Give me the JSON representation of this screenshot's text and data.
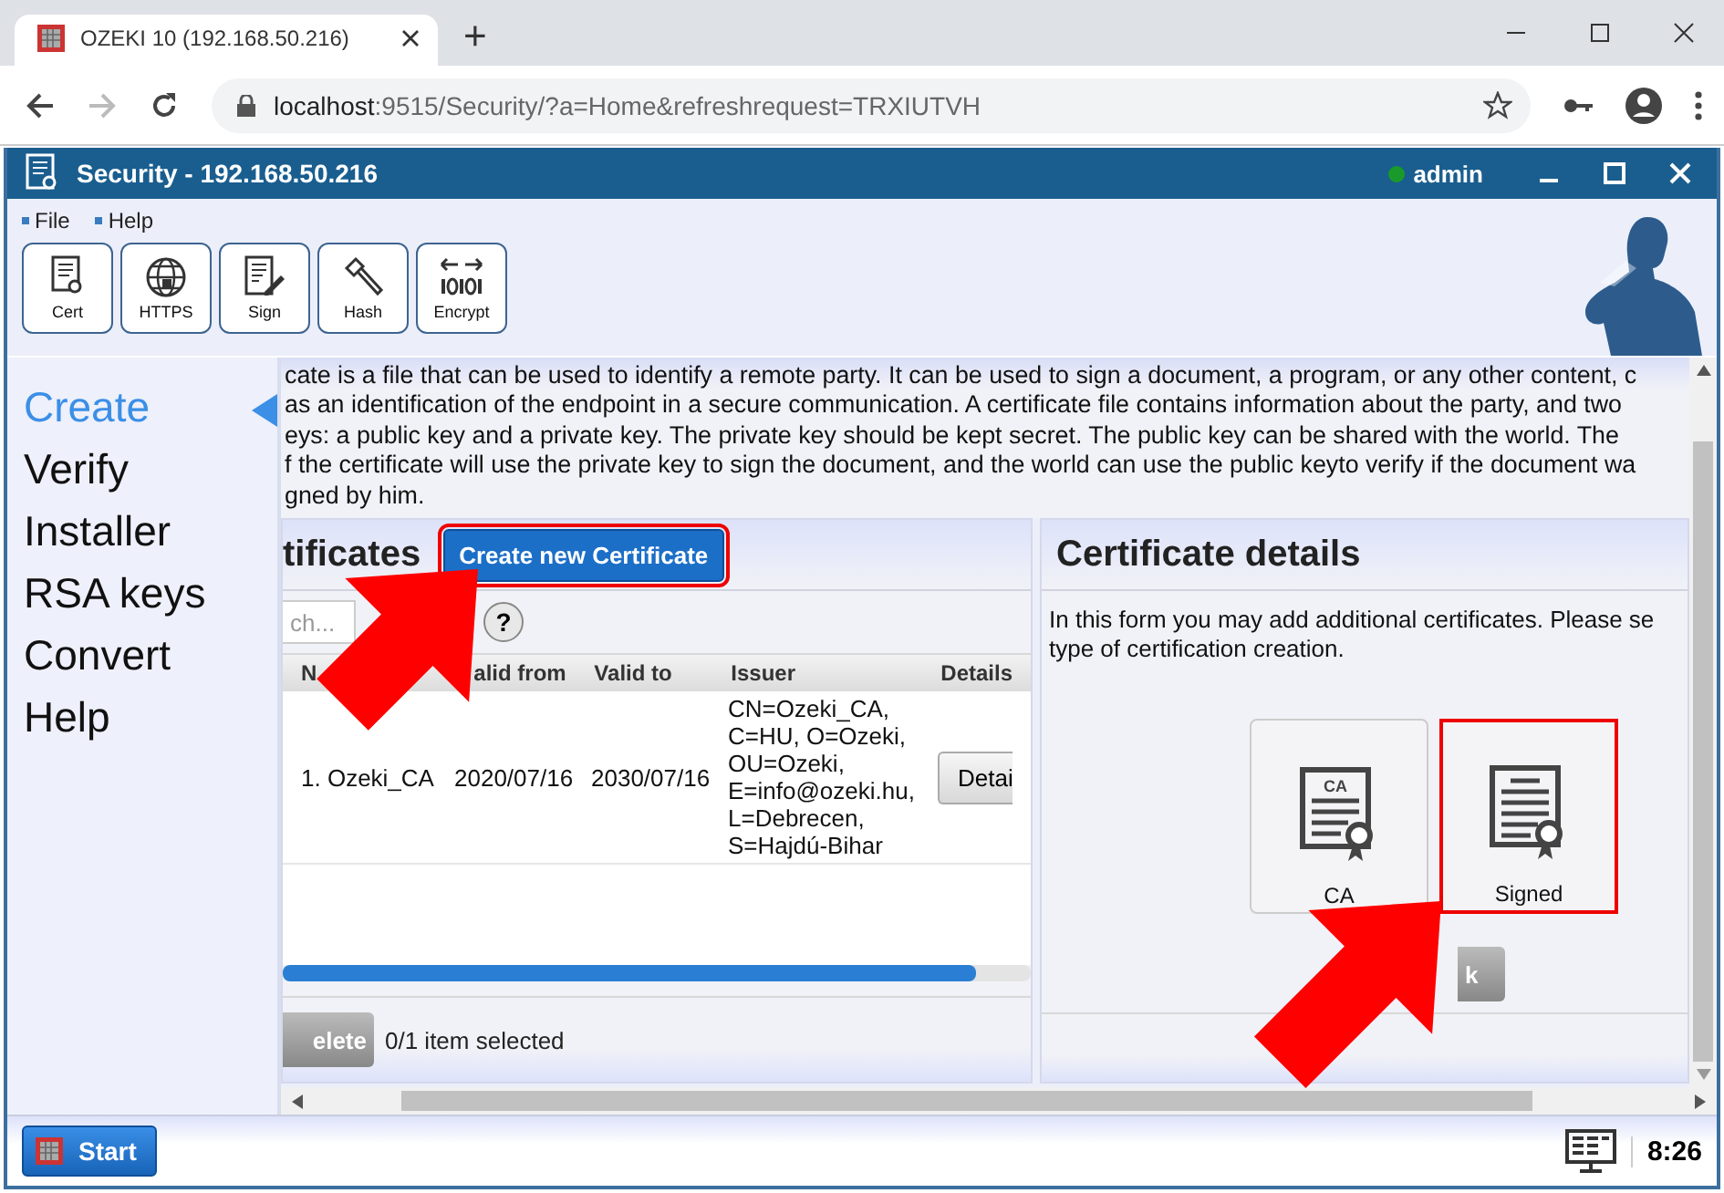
{
  "browser": {
    "tab_title": "OZEKI 10 (192.168.50.216)",
    "new_tab": "+",
    "url_host": "localhost",
    "url_rest": ":9515/Security/?a=Home&refreshrequest=TRXIUTVH"
  },
  "app": {
    "title": "Security - 192.168.50.216",
    "user": "admin",
    "user_online": true
  },
  "menu": [
    "File",
    "Help"
  ],
  "toolbar": [
    {
      "label": "Cert",
      "kind": "cert"
    },
    {
      "label": "HTTPS",
      "kind": "globe"
    },
    {
      "label": "Sign",
      "kind": "sign"
    },
    {
      "label": "Hash",
      "kind": "hash"
    },
    {
      "label": "Encrypt",
      "kind": "encrypt"
    }
  ],
  "sidebar": {
    "items": [
      {
        "label": "Create",
        "selected": true
      },
      {
        "label": "Verify",
        "selected": false
      },
      {
        "label": "Installer",
        "selected": false
      },
      {
        "label": "RSA keys",
        "selected": false
      },
      {
        "label": "Convert",
        "selected": false
      },
      {
        "label": "Help",
        "selected": false
      }
    ]
  },
  "description": {
    "lines": [
      "cate is a file that can be used to identify a remote party. It can be used to sign a document, a program, or any other content, c",
      "as an identification of the endpoint in a secure communication. A certificate file contains information about the party, and two",
      "eys: a public key and a private key. The private key should be kept secret. The public key can be shared with the world. The",
      "f the certificate will use the private key to sign the document, and the world can use the public keyto verify if the document wa",
      "gned by him."
    ]
  },
  "certificates_panel": {
    "title": "tificates",
    "create_button": {
      "label": "Create new Certificate",
      "highlighted": true
    },
    "search_placeholder": "ch...",
    "help": "?",
    "columns": [
      "N",
      "alid from",
      "Valid to",
      "Issuer",
      "Details"
    ],
    "rows": [
      {
        "number": "1.",
        "name": "Ozeki_CA",
        "valid_from": "2020/07/16",
        "valid_to": "2030/07/16",
        "issuer": [
          "CN=Ozeki_CA,",
          "C=HU, O=Ozeki,",
          "OU=Ozeki,",
          "E=info@ozeki.hu,",
          "L=Debrecen,",
          "S=Hajdú-Bihar"
        ],
        "details_button": "Detai"
      }
    ],
    "delete_button": "elete",
    "selection_status": "0/1 item selected"
  },
  "details_panel": {
    "title": "Certificate details",
    "description": [
      "In this form you may add additional certificates. Please se",
      "type of certification creation."
    ],
    "options": [
      {
        "label": "CA",
        "icon_text": "CA",
        "highlighted": false
      },
      {
        "label": "Signed",
        "highlighted": true
      }
    ],
    "back_button": "k"
  },
  "taskbar": {
    "start": "Start",
    "clock": "8:26"
  }
}
